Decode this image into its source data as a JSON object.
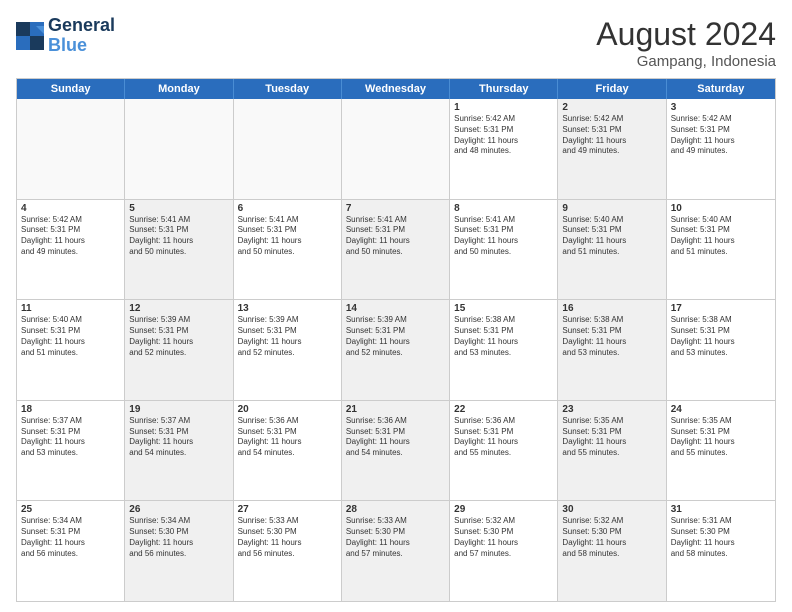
{
  "logo": {
    "line1": "General",
    "line2": "Blue"
  },
  "title": "August 2024",
  "location": "Gampang, Indonesia",
  "days_of_week": [
    "Sunday",
    "Monday",
    "Tuesday",
    "Wednesday",
    "Thursday",
    "Friday",
    "Saturday"
  ],
  "rows": [
    [
      {
        "day": "",
        "text": "",
        "empty": true
      },
      {
        "day": "",
        "text": "",
        "empty": true
      },
      {
        "day": "",
        "text": "",
        "empty": true
      },
      {
        "day": "",
        "text": "",
        "empty": true
      },
      {
        "day": "1",
        "text": "Sunrise: 5:42 AM\nSunset: 5:31 PM\nDaylight: 11 hours\nand 48 minutes.",
        "shaded": false
      },
      {
        "day": "2",
        "text": "Sunrise: 5:42 AM\nSunset: 5:31 PM\nDaylight: 11 hours\nand 49 minutes.",
        "shaded": true
      },
      {
        "day": "3",
        "text": "Sunrise: 5:42 AM\nSunset: 5:31 PM\nDaylight: 11 hours\nand 49 minutes.",
        "shaded": false
      }
    ],
    [
      {
        "day": "4",
        "text": "Sunrise: 5:42 AM\nSunset: 5:31 PM\nDaylight: 11 hours\nand 49 minutes.",
        "shaded": false
      },
      {
        "day": "5",
        "text": "Sunrise: 5:41 AM\nSunset: 5:31 PM\nDaylight: 11 hours\nand 50 minutes.",
        "shaded": true
      },
      {
        "day": "6",
        "text": "Sunrise: 5:41 AM\nSunset: 5:31 PM\nDaylight: 11 hours\nand 50 minutes.",
        "shaded": false
      },
      {
        "day": "7",
        "text": "Sunrise: 5:41 AM\nSunset: 5:31 PM\nDaylight: 11 hours\nand 50 minutes.",
        "shaded": true
      },
      {
        "day": "8",
        "text": "Sunrise: 5:41 AM\nSunset: 5:31 PM\nDaylight: 11 hours\nand 50 minutes.",
        "shaded": false
      },
      {
        "day": "9",
        "text": "Sunrise: 5:40 AM\nSunset: 5:31 PM\nDaylight: 11 hours\nand 51 minutes.",
        "shaded": true
      },
      {
        "day": "10",
        "text": "Sunrise: 5:40 AM\nSunset: 5:31 PM\nDaylight: 11 hours\nand 51 minutes.",
        "shaded": false
      }
    ],
    [
      {
        "day": "11",
        "text": "Sunrise: 5:40 AM\nSunset: 5:31 PM\nDaylight: 11 hours\nand 51 minutes.",
        "shaded": false
      },
      {
        "day": "12",
        "text": "Sunrise: 5:39 AM\nSunset: 5:31 PM\nDaylight: 11 hours\nand 52 minutes.",
        "shaded": true
      },
      {
        "day": "13",
        "text": "Sunrise: 5:39 AM\nSunset: 5:31 PM\nDaylight: 11 hours\nand 52 minutes.",
        "shaded": false
      },
      {
        "day": "14",
        "text": "Sunrise: 5:39 AM\nSunset: 5:31 PM\nDaylight: 11 hours\nand 52 minutes.",
        "shaded": true
      },
      {
        "day": "15",
        "text": "Sunrise: 5:38 AM\nSunset: 5:31 PM\nDaylight: 11 hours\nand 53 minutes.",
        "shaded": false
      },
      {
        "day": "16",
        "text": "Sunrise: 5:38 AM\nSunset: 5:31 PM\nDaylight: 11 hours\nand 53 minutes.",
        "shaded": true
      },
      {
        "day": "17",
        "text": "Sunrise: 5:38 AM\nSunset: 5:31 PM\nDaylight: 11 hours\nand 53 minutes.",
        "shaded": false
      }
    ],
    [
      {
        "day": "18",
        "text": "Sunrise: 5:37 AM\nSunset: 5:31 PM\nDaylight: 11 hours\nand 53 minutes.",
        "shaded": false
      },
      {
        "day": "19",
        "text": "Sunrise: 5:37 AM\nSunset: 5:31 PM\nDaylight: 11 hours\nand 54 minutes.",
        "shaded": true
      },
      {
        "day": "20",
        "text": "Sunrise: 5:36 AM\nSunset: 5:31 PM\nDaylight: 11 hours\nand 54 minutes.",
        "shaded": false
      },
      {
        "day": "21",
        "text": "Sunrise: 5:36 AM\nSunset: 5:31 PM\nDaylight: 11 hours\nand 54 minutes.",
        "shaded": true
      },
      {
        "day": "22",
        "text": "Sunrise: 5:36 AM\nSunset: 5:31 PM\nDaylight: 11 hours\nand 55 minutes.",
        "shaded": false
      },
      {
        "day": "23",
        "text": "Sunrise: 5:35 AM\nSunset: 5:31 PM\nDaylight: 11 hours\nand 55 minutes.",
        "shaded": true
      },
      {
        "day": "24",
        "text": "Sunrise: 5:35 AM\nSunset: 5:31 PM\nDaylight: 11 hours\nand 55 minutes.",
        "shaded": false
      }
    ],
    [
      {
        "day": "25",
        "text": "Sunrise: 5:34 AM\nSunset: 5:31 PM\nDaylight: 11 hours\nand 56 minutes.",
        "shaded": false
      },
      {
        "day": "26",
        "text": "Sunrise: 5:34 AM\nSunset: 5:30 PM\nDaylight: 11 hours\nand 56 minutes.",
        "shaded": true
      },
      {
        "day": "27",
        "text": "Sunrise: 5:33 AM\nSunset: 5:30 PM\nDaylight: 11 hours\nand 56 minutes.",
        "shaded": false
      },
      {
        "day": "28",
        "text": "Sunrise: 5:33 AM\nSunset: 5:30 PM\nDaylight: 11 hours\nand 57 minutes.",
        "shaded": true
      },
      {
        "day": "29",
        "text": "Sunrise: 5:32 AM\nSunset: 5:30 PM\nDaylight: 11 hours\nand 57 minutes.",
        "shaded": false
      },
      {
        "day": "30",
        "text": "Sunrise: 5:32 AM\nSunset: 5:30 PM\nDaylight: 11 hours\nand 58 minutes.",
        "shaded": true
      },
      {
        "day": "31",
        "text": "Sunrise: 5:31 AM\nSunset: 5:30 PM\nDaylight: 11 hours\nand 58 minutes.",
        "shaded": false
      }
    ]
  ]
}
